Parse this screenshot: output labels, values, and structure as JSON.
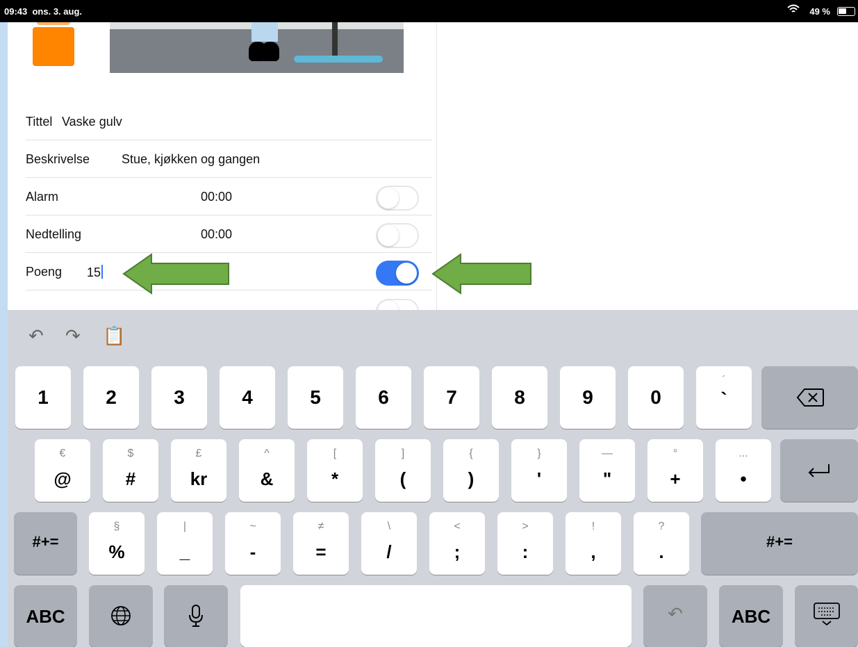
{
  "status_bar": {
    "time": "09:43",
    "date": "ons. 3. aug.",
    "battery": "49 %"
  },
  "form": {
    "title_label": "Tittel",
    "title_value": "Vaske gulv",
    "description_label": "Beskrivelse",
    "description_value": "Stue, kjøkken og gangen",
    "alarm_label": "Alarm",
    "alarm_time": "00:00",
    "alarm_on": false,
    "countdown_label": "Nedtelling",
    "countdown_time": "00:00",
    "countdown_on": false,
    "points_label": "Poeng",
    "points_value": "15",
    "points_on": true
  },
  "annotations": {
    "arrow_color": "#70ad47"
  },
  "keyboard": {
    "toolbar": [
      "undo-icon",
      "redo-icon",
      "paste-icon"
    ],
    "row1": [
      "1",
      "2",
      "3",
      "4",
      "5",
      "6",
      "7",
      "8",
      "9",
      "0"
    ],
    "row1_last_sub": "´",
    "row1_last_main": "`",
    "row2": [
      {
        "sub": "€",
        "main": "@"
      },
      {
        "sub": "$",
        "main": "#"
      },
      {
        "sub": "£",
        "main": "kr"
      },
      {
        "sub": "^",
        "main": "&"
      },
      {
        "sub": "[",
        "main": "*"
      },
      {
        "sub": "]",
        "main": "("
      },
      {
        "sub": "{",
        "main": ")"
      },
      {
        "sub": "}",
        "main": "'"
      },
      {
        "sub": "—",
        "main": "\""
      },
      {
        "sub": "°",
        "main": "+"
      },
      {
        "sub": "...",
        "main": "•"
      }
    ],
    "row3_left": "#+=",
    "row3": [
      {
        "sub": "§",
        "main": "%"
      },
      {
        "sub": "|",
        "main": "_"
      },
      {
        "sub": "~",
        "main": "-"
      },
      {
        "sub": "≠",
        "main": "="
      },
      {
        "sub": "\\",
        "main": "/"
      },
      {
        "sub": "<",
        "main": ";"
      },
      {
        "sub": ">",
        "main": ":"
      },
      {
        "sub": "!",
        "main": ","
      },
      {
        "sub": "?",
        "main": "."
      }
    ],
    "row3_right": "#+=",
    "abc_left": "ABC",
    "abc_right": "ABC"
  }
}
